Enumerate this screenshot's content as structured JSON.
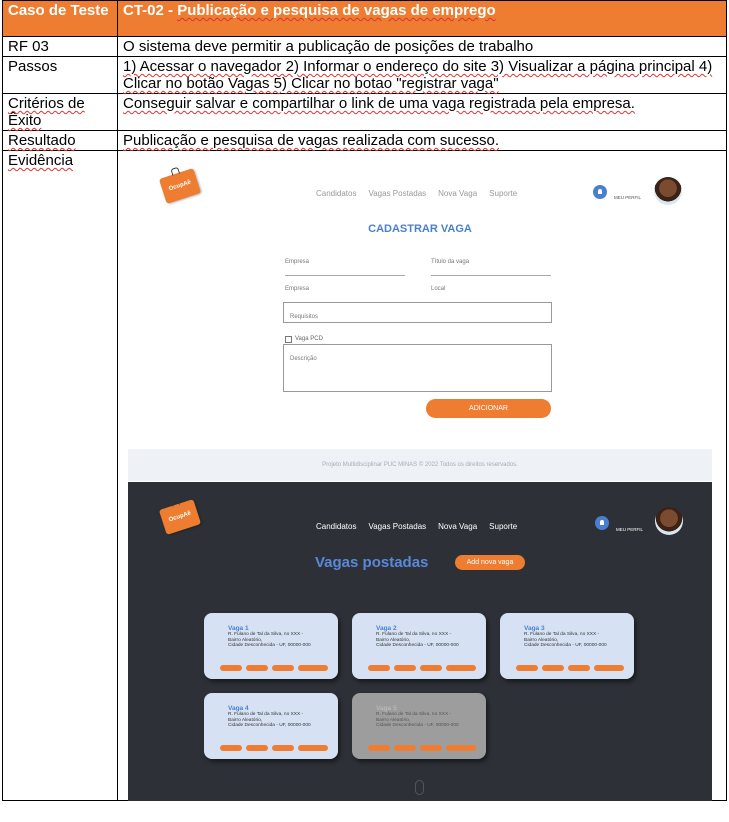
{
  "table": {
    "header": {
      "label": "Caso de Teste",
      "value_prefix": "CT-02 - ",
      "value_underlined": "Publicação e pesquisa de vagas de emprego"
    },
    "rows": [
      {
        "label": "RF 03",
        "value": "O sistema deve permitir a publicação de posições de trabalho"
      },
      {
        "label": "Passos",
        "value": "1) Acessar o navegador 2) Informar o endereço do site 3) Visualizar a página principal 4) Clicar no botão Vagas 5) Clicar no botao \"registrar vaga\""
      },
      {
        "label": "Critérios de Êxito",
        "value": "Conseguir salvar e compartilhar o link de uma vaga registrada pela empresa."
      },
      {
        "label": "Resultado",
        "value": "Publicação e pesquisa de vagas realizada com sucesso."
      },
      {
        "label": "Evidência"
      }
    ]
  },
  "evidence": {
    "logo_text": "OcupAê",
    "nav": [
      "Candidatos",
      "Vagas Postadas",
      "Nova Vaga",
      "Suporte"
    ],
    "profile_label": "MEU PERFIL",
    "form": {
      "title": "CADASTRAR VAGA",
      "fields": {
        "empresa1": "Empresa",
        "titulo": "Título da vaga",
        "empresa2": "Empresa",
        "local": "Local",
        "requisitos": "Requisitos",
        "pcd": "Vaga PCD",
        "descricao": "Descrição"
      },
      "submit": "ADICIONAR",
      "footer": "Projeto Multidisciplinar PUC MINAS © 2022 Todos os direitos reservados."
    },
    "posted": {
      "title": "Vagas postadas",
      "add_button": "Add nova vaga",
      "address_line1": "R. Fulano de Tal da Silva, no XXX -",
      "address_line2": "Bairro Aleatório,",
      "address_line3": "Cidade Desconhecida - UF, 00000-000",
      "cards": [
        {
          "title": "Vaga 1"
        },
        {
          "title": "Vaga 2"
        },
        {
          "title": "Vaga 3"
        },
        {
          "title": "Vaga 4"
        },
        {
          "title": "Vaga 5"
        }
      ]
    },
    "colors": {
      "accent": "#ee7d31",
      "blue": "#4a7fd0",
      "dark_bg": "#2d3137",
      "card": "#d6e2f3"
    }
  }
}
